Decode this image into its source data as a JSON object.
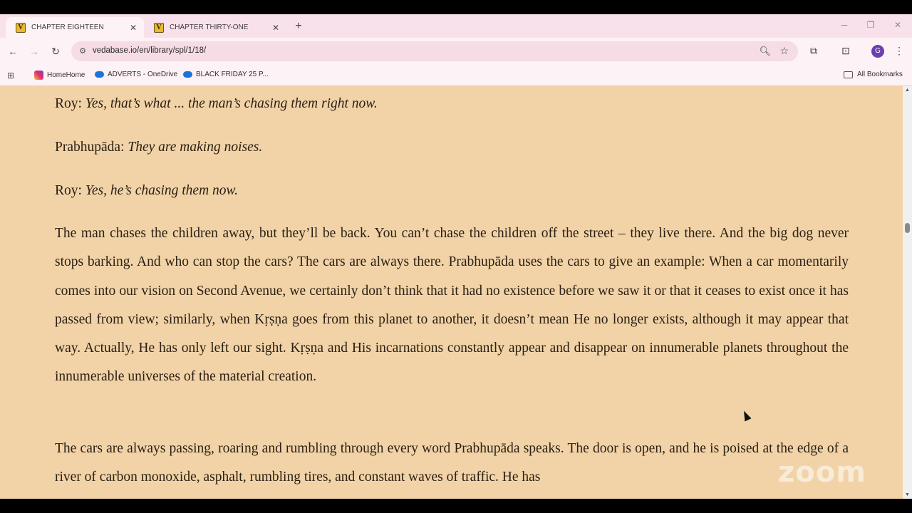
{
  "tabs": [
    {
      "favicon": "V",
      "title": "CHAPTER EIGHTEEN",
      "active": true
    },
    {
      "favicon": "V",
      "title": "CHAPTER THIRTY-ONE",
      "active": false
    }
  ],
  "toolbar": {
    "url": "vedabase.io/en/library/spl/1/18/",
    "avatar_letter": "G"
  },
  "bookmarks": [
    {
      "label": "HomeHome",
      "icon": "instagram-icon"
    },
    {
      "label": "ADVERTS - OneDrive",
      "icon": "onedrive-icon"
    },
    {
      "label": "BLACK FRIDAY 25 P...",
      "icon": "onedrive-icon"
    }
  ],
  "all_bookmarks": "All Bookmarks",
  "article": {
    "p1_speaker": "Roy: ",
    "p1_text": "Yes, that’s what ... the man’s chasing them right now.",
    "p2_speaker": "Prabhupāda: ",
    "p2_text": "They are making noises.",
    "p3_speaker": "Roy: ",
    "p3_text": "Yes, he’s chasing them now.",
    "p4_text": "The man chases the children away, but they’ll be back. You can’t chase the children off the street – they live there. And the big dog never stops barking. And who can stop the cars? The cars are always there. Prabhupāda uses the cars to give an example: When a car momentarily comes into our vision on Second Avenue, we certainly don’t think that it had no existence before we saw it or that it ceases to exist once it has passed from view; similarly, when Kṛṣṇa goes from this planet to another, it doesn’t mean He no longer exists, although it may appear that way. Actually, He has only left our sight. Kṛṣṇa and His incarnations constantly appear and disappear on innumerable planets throughout the innumerable universes of the material creation.",
    "p5_text": "The cars are always passing, roaring and rumbling through every word Prabhupāda speaks. The door is open, and he is poised at the edge of a river of carbon monoxide, asphalt, rumbling tires, and constant waves of traffic. He has"
  },
  "watermark": "zoom",
  "colors": {
    "page_bg": "#f2d3a7",
    "chrome": "#fdf2f6",
    "text": "#2a2015"
  }
}
